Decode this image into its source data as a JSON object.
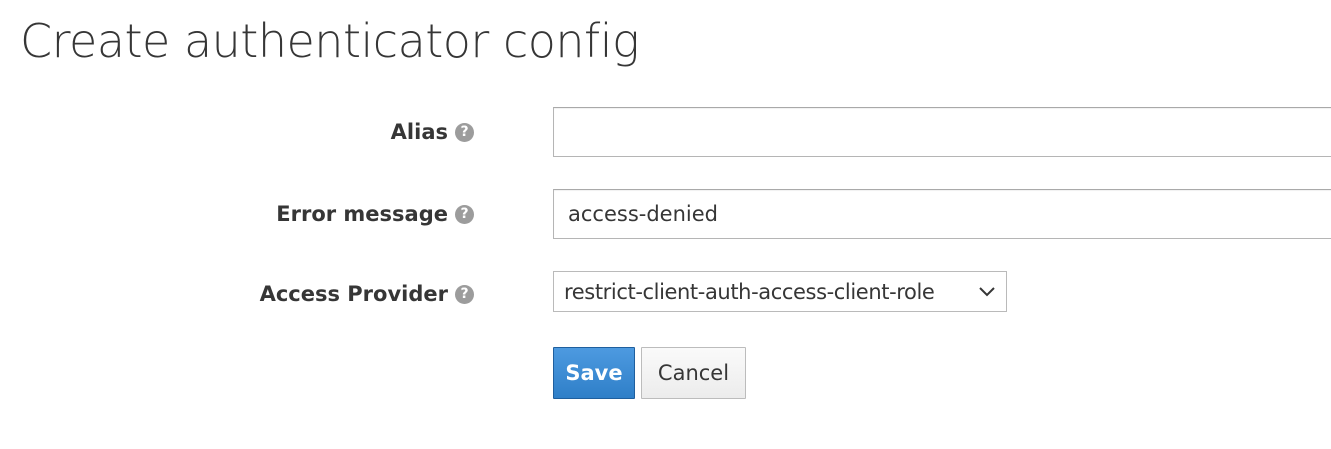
{
  "page": {
    "title": "Create authenticator config"
  },
  "form": {
    "alias": {
      "label": "Alias",
      "value": "",
      "placeholder": ""
    },
    "error_message": {
      "label": "Error message",
      "value": "access-denied"
    },
    "access_provider": {
      "label": "Access Provider",
      "selected": "restrict-client-auth-access-client-role"
    },
    "help_glyph": "?"
  },
  "actions": {
    "save_label": "Save",
    "cancel_label": "Cancel"
  },
  "colors": {
    "primary": "#3a87d2",
    "text": "#363636",
    "help_icon": "#9c9c9c"
  },
  "icons": {
    "help": "question-circle-icon",
    "select": "chevron-down-icon"
  }
}
